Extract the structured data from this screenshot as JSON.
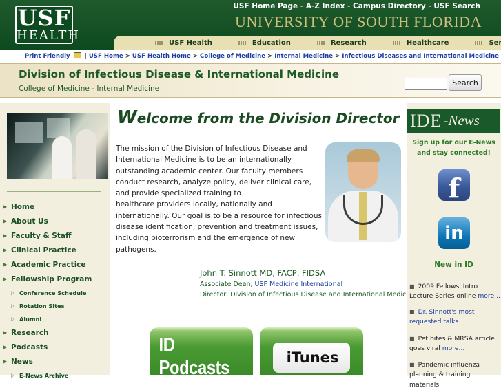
{
  "header": {
    "logo_top": "USF",
    "logo_bottom": "HEALTH",
    "top_links": "USF Home Page - A-Z Index - Campus Directory - USF Search",
    "university": "UNIVERSITY OF SOUTH FLORIDA",
    "nav": [
      "USF Health",
      "Education",
      "Research",
      "Healthcare",
      "Service"
    ]
  },
  "breadcrumb": {
    "print": "Print Friendly",
    "items": [
      "USF Home",
      "USF Health Home",
      "College of Medicine",
      "Internal Medicine",
      "Infectious Diseases and International Medicine"
    ]
  },
  "banner": {
    "title": "Division of Infectious Disease & International Medicine",
    "subtitle": "College of Medicine - Internal Medicine",
    "search_value": "",
    "search_button": "Search"
  },
  "sidebar": {
    "items": [
      {
        "label": "Home",
        "sub": false
      },
      {
        "label": "About Us",
        "sub": false
      },
      {
        "label": "Faculty & Staff",
        "sub": false
      },
      {
        "label": "Clinical Practice",
        "sub": false
      },
      {
        "label": "Academic Practice",
        "sub": false
      },
      {
        "label": "Fellowship Program",
        "sub": false
      },
      {
        "label": "Conference Schedule",
        "sub": true
      },
      {
        "label": "Rotation Sites",
        "sub": true
      },
      {
        "label": "Alumni",
        "sub": true
      },
      {
        "label": "Research",
        "sub": false
      },
      {
        "label": "Podcasts",
        "sub": false
      },
      {
        "label": "News",
        "sub": false
      },
      {
        "label": "E-News Archive",
        "sub": true
      }
    ]
  },
  "main": {
    "welcome_cap": "W",
    "welcome_rest": "elcome from the Division Director",
    "mission_lines": [
      "The mission of the Division of Infectious Disease and",
      "International Medicine is to be an internationally",
      "outstanding academic center. Our faculty members",
      "conduct research, analyze policy, deliver clinical care,",
      "and provide specialized training to",
      "healthcare providers locally, nationally and",
      "internationally. Our goal is to be a resource for infectious",
      "disease identification, prevention and treatment issues,",
      "including bioterrorism and the emergence of new",
      "pathogens."
    ],
    "sig_name": "John T. Sinnott MD, FACP, FIDSA",
    "sig_line1_prefix": "Associate Dean, ",
    "sig_line1_link": "USF Medicine International",
    "sig_line2": "Director, Division of Infectious Disease and International Medicine",
    "podcasts_button": "ID Podcasts",
    "itunes_button": "iTunes"
  },
  "right": {
    "enews_id": "IDE",
    "enews_word": "-News",
    "signup": "Sign up for our E-News and stay connected!",
    "facebook_letter": "f",
    "linkedin_text": "in",
    "news_heading": "New in ID",
    "news": [
      {
        "text": "2009 Fellows' Intro Lecture Series online ",
        "link": "more..."
      },
      {
        "text": "",
        "link": "Dr. Sinnott's most requested talks"
      },
      {
        "text": "Pet bites & MRSA article goes viral ",
        "link": "more..."
      },
      {
        "text": "Pandemic influenza planning & training materials",
        "link": ""
      }
    ]
  }
}
